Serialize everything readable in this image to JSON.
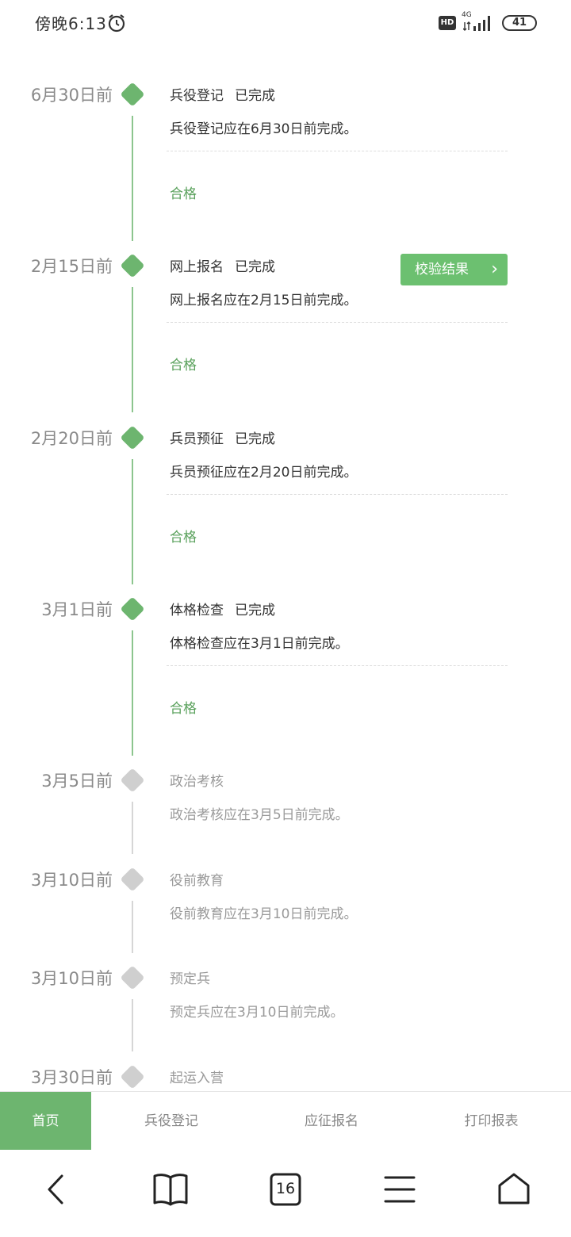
{
  "status_bar": {
    "time": "傍晚6:13",
    "hd": "HD",
    "network": "4G",
    "battery": "41"
  },
  "timeline": [
    {
      "date": "6月30日前",
      "title": "兵役登记",
      "status": "已完成",
      "desc": "兵役登记应在6月30日前完成。",
      "result": "合格"
    },
    {
      "date": "2月15日前",
      "title": "网上报名",
      "status": "已完成",
      "desc": "网上报名应在2月15日前完成。",
      "result": "合格",
      "button": "校验结果"
    },
    {
      "date": "2月20日前",
      "title": "兵员预征",
      "status": "已完成",
      "desc": "兵员预征应在2月20日前完成。",
      "result": "合格"
    },
    {
      "date": "3月1日前",
      "title": "体格检查",
      "status": "已完成",
      "desc": "体格检查应在3月1日前完成。",
      "result": "合格"
    },
    {
      "date": "3月5日前",
      "title": "政治考核",
      "desc": "政治考核应在3月5日前完成。"
    },
    {
      "date": "3月10日前",
      "title": "役前教育",
      "desc": "役前教育应在3月10日前完成。"
    },
    {
      "date": "3月10日前",
      "title": "预定兵",
      "desc": "预定兵应在3月10日前完成。"
    },
    {
      "date": "3月30日前",
      "title": "起运入营"
    }
  ],
  "bottom_nav": [
    "首页",
    "兵役登记",
    "应征报名",
    "打印报表"
  ],
  "browser": {
    "tab_count": "16"
  },
  "colors": {
    "accent": "#6db56f",
    "button": "#6cc070",
    "pending": "#cfcfcf"
  }
}
